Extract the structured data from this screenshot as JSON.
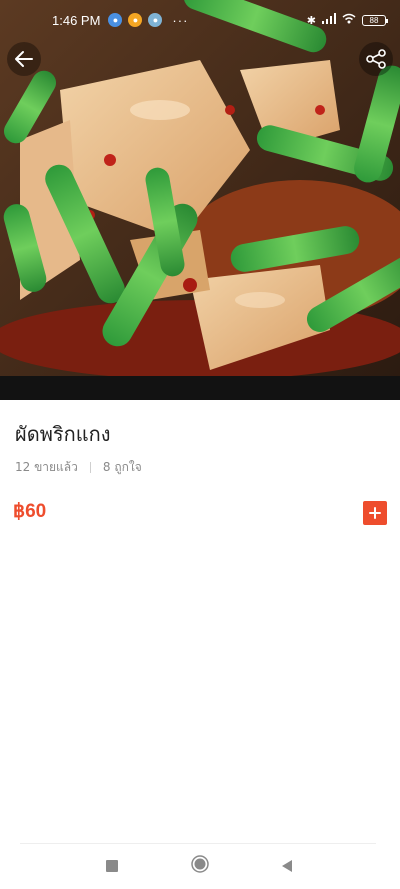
{
  "status_bar": {
    "time": "1:46 PM",
    "more": "···",
    "battery": "88"
  },
  "icons": {
    "back": "arrow-left-icon",
    "share": "share-icon",
    "add": "plus-icon",
    "nav_recents": "square-icon",
    "nav_home": "circle-icon",
    "nav_back": "triangle-back-icon"
  },
  "product": {
    "name": "ผัดพริกแกง",
    "sold": "12 ขายแล้ว",
    "likes": "8 ถูกใจ",
    "price": "฿60"
  },
  "colors": {
    "accent": "#ee4d2d",
    "text_primary": "#222222",
    "text_secondary": "#8a8a8a"
  }
}
